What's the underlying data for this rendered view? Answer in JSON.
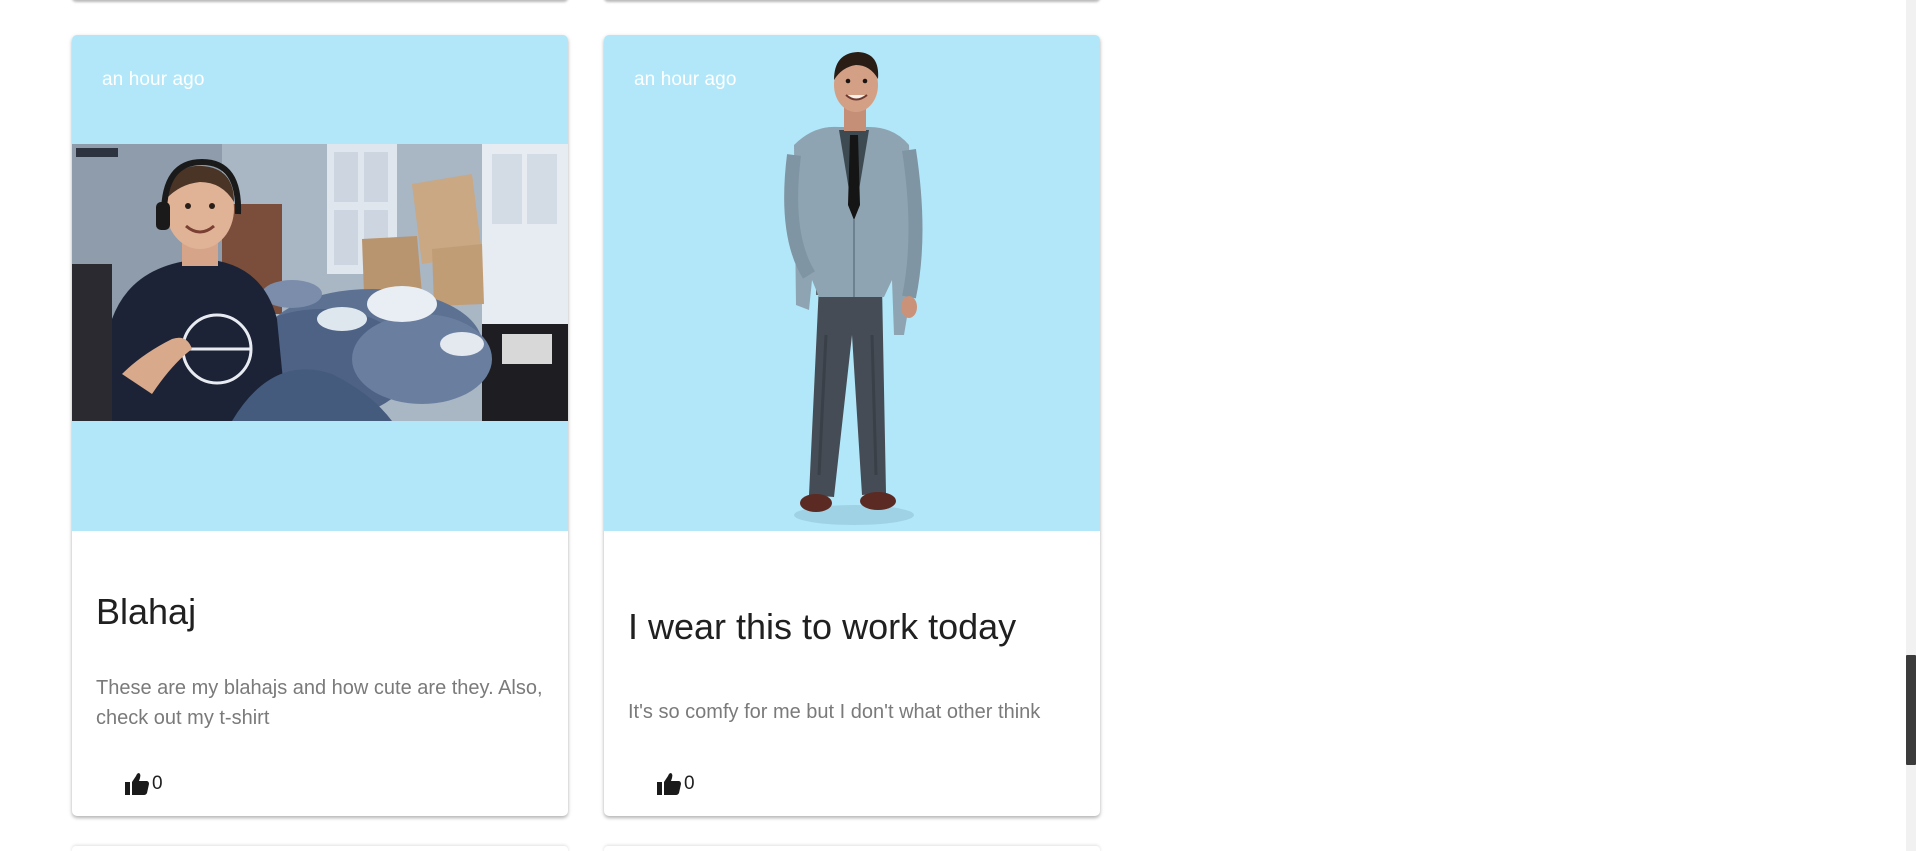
{
  "colors": {
    "media_background": "#b1e7f9",
    "title": "#202020",
    "description": "#7a7a7a",
    "timestamp": "#ffffff"
  },
  "posts": [
    {
      "timestamp": "an hour ago",
      "title": "Blahaj",
      "description": "These are my blahajs and how cute are they. Also, check out my t-shirt",
      "likes": "0",
      "like_icon": "thumbs-up-icon"
    },
    {
      "timestamp": "an hour ago",
      "title": "I wear this to work today",
      "description": "It's so comfy for me but I don't what other think",
      "likes": "0",
      "like_icon": "thumbs-up-icon"
    }
  ]
}
